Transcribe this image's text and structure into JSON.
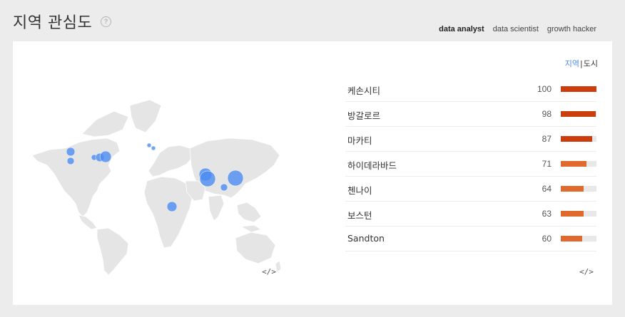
{
  "page": {
    "title": "지역 관심도"
  },
  "tabs": [
    {
      "label": "data analyst",
      "active": true
    },
    {
      "label": "data scientist",
      "active": false
    },
    {
      "label": "growth hacker",
      "active": false
    }
  ],
  "toggle": {
    "region": "지역",
    "separator": "|",
    "city": "도시"
  },
  "embed": {
    "symbol": "</>"
  },
  "colors": {
    "accent": "#4a8af4",
    "bar_high": "#cc3d0e",
    "bar_mid": "#e06a2e",
    "track": "#e8e8e8"
  },
  "ranking": [
    {
      "name": "케손시티",
      "value": 100
    },
    {
      "name": "방갈로르",
      "value": 98
    },
    {
      "name": "마카티",
      "value": 87
    },
    {
      "name": "하이데라바드",
      "value": 71
    },
    {
      "name": "첸나이",
      "value": 64
    },
    {
      "name": "보스턴",
      "value": 63
    },
    {
      "name": "Sandton",
      "value": 60
    }
  ]
}
